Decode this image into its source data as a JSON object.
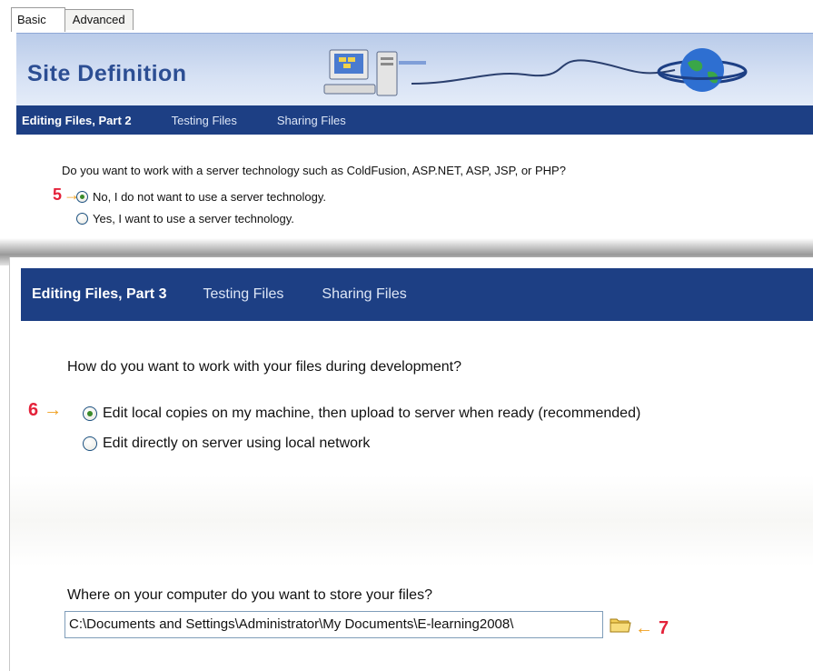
{
  "tabs": [
    {
      "label": "Basic",
      "active": true
    },
    {
      "label": "Advanced",
      "active": false
    }
  ],
  "banner": {
    "title": "Site Definition"
  },
  "part2": {
    "nav": [
      {
        "label": "Editing Files, Part 2",
        "active": true
      },
      {
        "label": "Testing Files",
        "active": false
      },
      {
        "label": "Sharing Files",
        "active": false
      }
    ],
    "question": "Do you want to work with a server technology such as ColdFusion, ASP.NET, ASP, JSP, or PHP?",
    "options": [
      {
        "label": "No, I do not want to use a server technology.",
        "selected": true
      },
      {
        "label": "Yes, I want to use a server technology.",
        "selected": false
      }
    ],
    "step_marker": "5"
  },
  "part3": {
    "nav": [
      {
        "label": "Editing Files, Part 3",
        "active": true
      },
      {
        "label": "Testing Files",
        "active": false
      },
      {
        "label": "Sharing Files",
        "active": false
      }
    ],
    "question": "How do you want to work with your files during development?",
    "options": [
      {
        "label": "Edit local copies on my machine, then upload to server when ready (recommended)",
        "selected": true
      },
      {
        "label": "Edit directly on server using local network",
        "selected": false
      }
    ],
    "step_marker": "6",
    "storage": {
      "label": "Where on your computer do you want to store your files?",
      "value": "C:\\Documents and Settings\\Administrator\\My Documents\\E-learning2008\\"
    },
    "folder_step_marker": "7"
  },
  "icons": {
    "folder": "folder-icon",
    "arrow": "arrow-right-icon",
    "computer": "computer-icon",
    "globe": "globe-icon"
  },
  "colors": {
    "nav_bg": "#1d3f84",
    "banner_title": "#2c4e93",
    "step_number": "#e4223a",
    "step_arrow": "#f0a020",
    "radio_dot": "#3a8a2a"
  }
}
